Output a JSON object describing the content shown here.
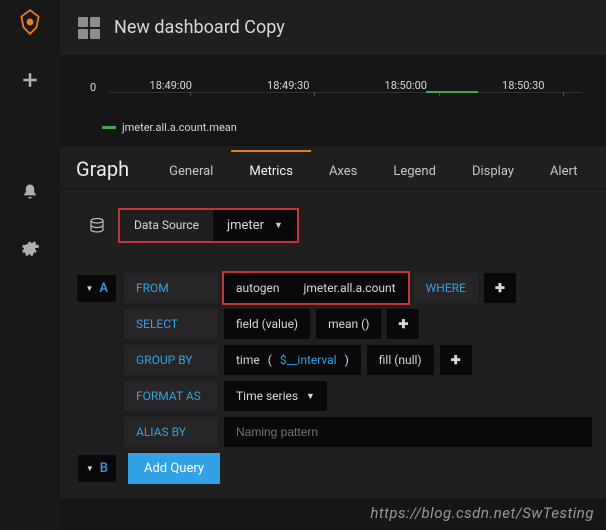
{
  "header": {
    "title": "New dashboard Copy"
  },
  "chart_data": {
    "type": "line",
    "x": [
      "18:49:00",
      "18:49:30",
      "18:50:00",
      "18:50:30"
    ],
    "ylim": [
      0,
      0
    ],
    "y_ticks": [
      "0"
    ],
    "series": [
      {
        "name": "jmeter.all.a.count.mean",
        "color": "#47a64a",
        "values": [
          0,
          0,
          0,
          0
        ]
      }
    ]
  },
  "editor": {
    "title": "Graph",
    "tabs": [
      "General",
      "Metrics",
      "Axes",
      "Legend",
      "Display",
      "Alert"
    ],
    "active_tab": "Metrics",
    "datasource_label": "Data Source",
    "datasource": "jmeter"
  },
  "queries": {
    "a": {
      "letter": "A",
      "from_label": "FROM",
      "policy": "autogen",
      "measurement": "jmeter.all.a.count",
      "where_label": "WHERE",
      "select_label": "SELECT",
      "field": "field (value)",
      "agg": "mean ()",
      "groupby_label": "GROUP BY",
      "time_fn": "time",
      "time_arg": "$__interval",
      "fill": "fill (null)",
      "format_label": "FORMAT AS",
      "format_value": "Time series",
      "alias_label": "ALIAS BY",
      "alias_placeholder": "Naming pattern"
    },
    "b": {
      "letter": "B",
      "add_label": "Add Query"
    }
  },
  "watermark": "https://blog.csdn.net/SwTesting"
}
